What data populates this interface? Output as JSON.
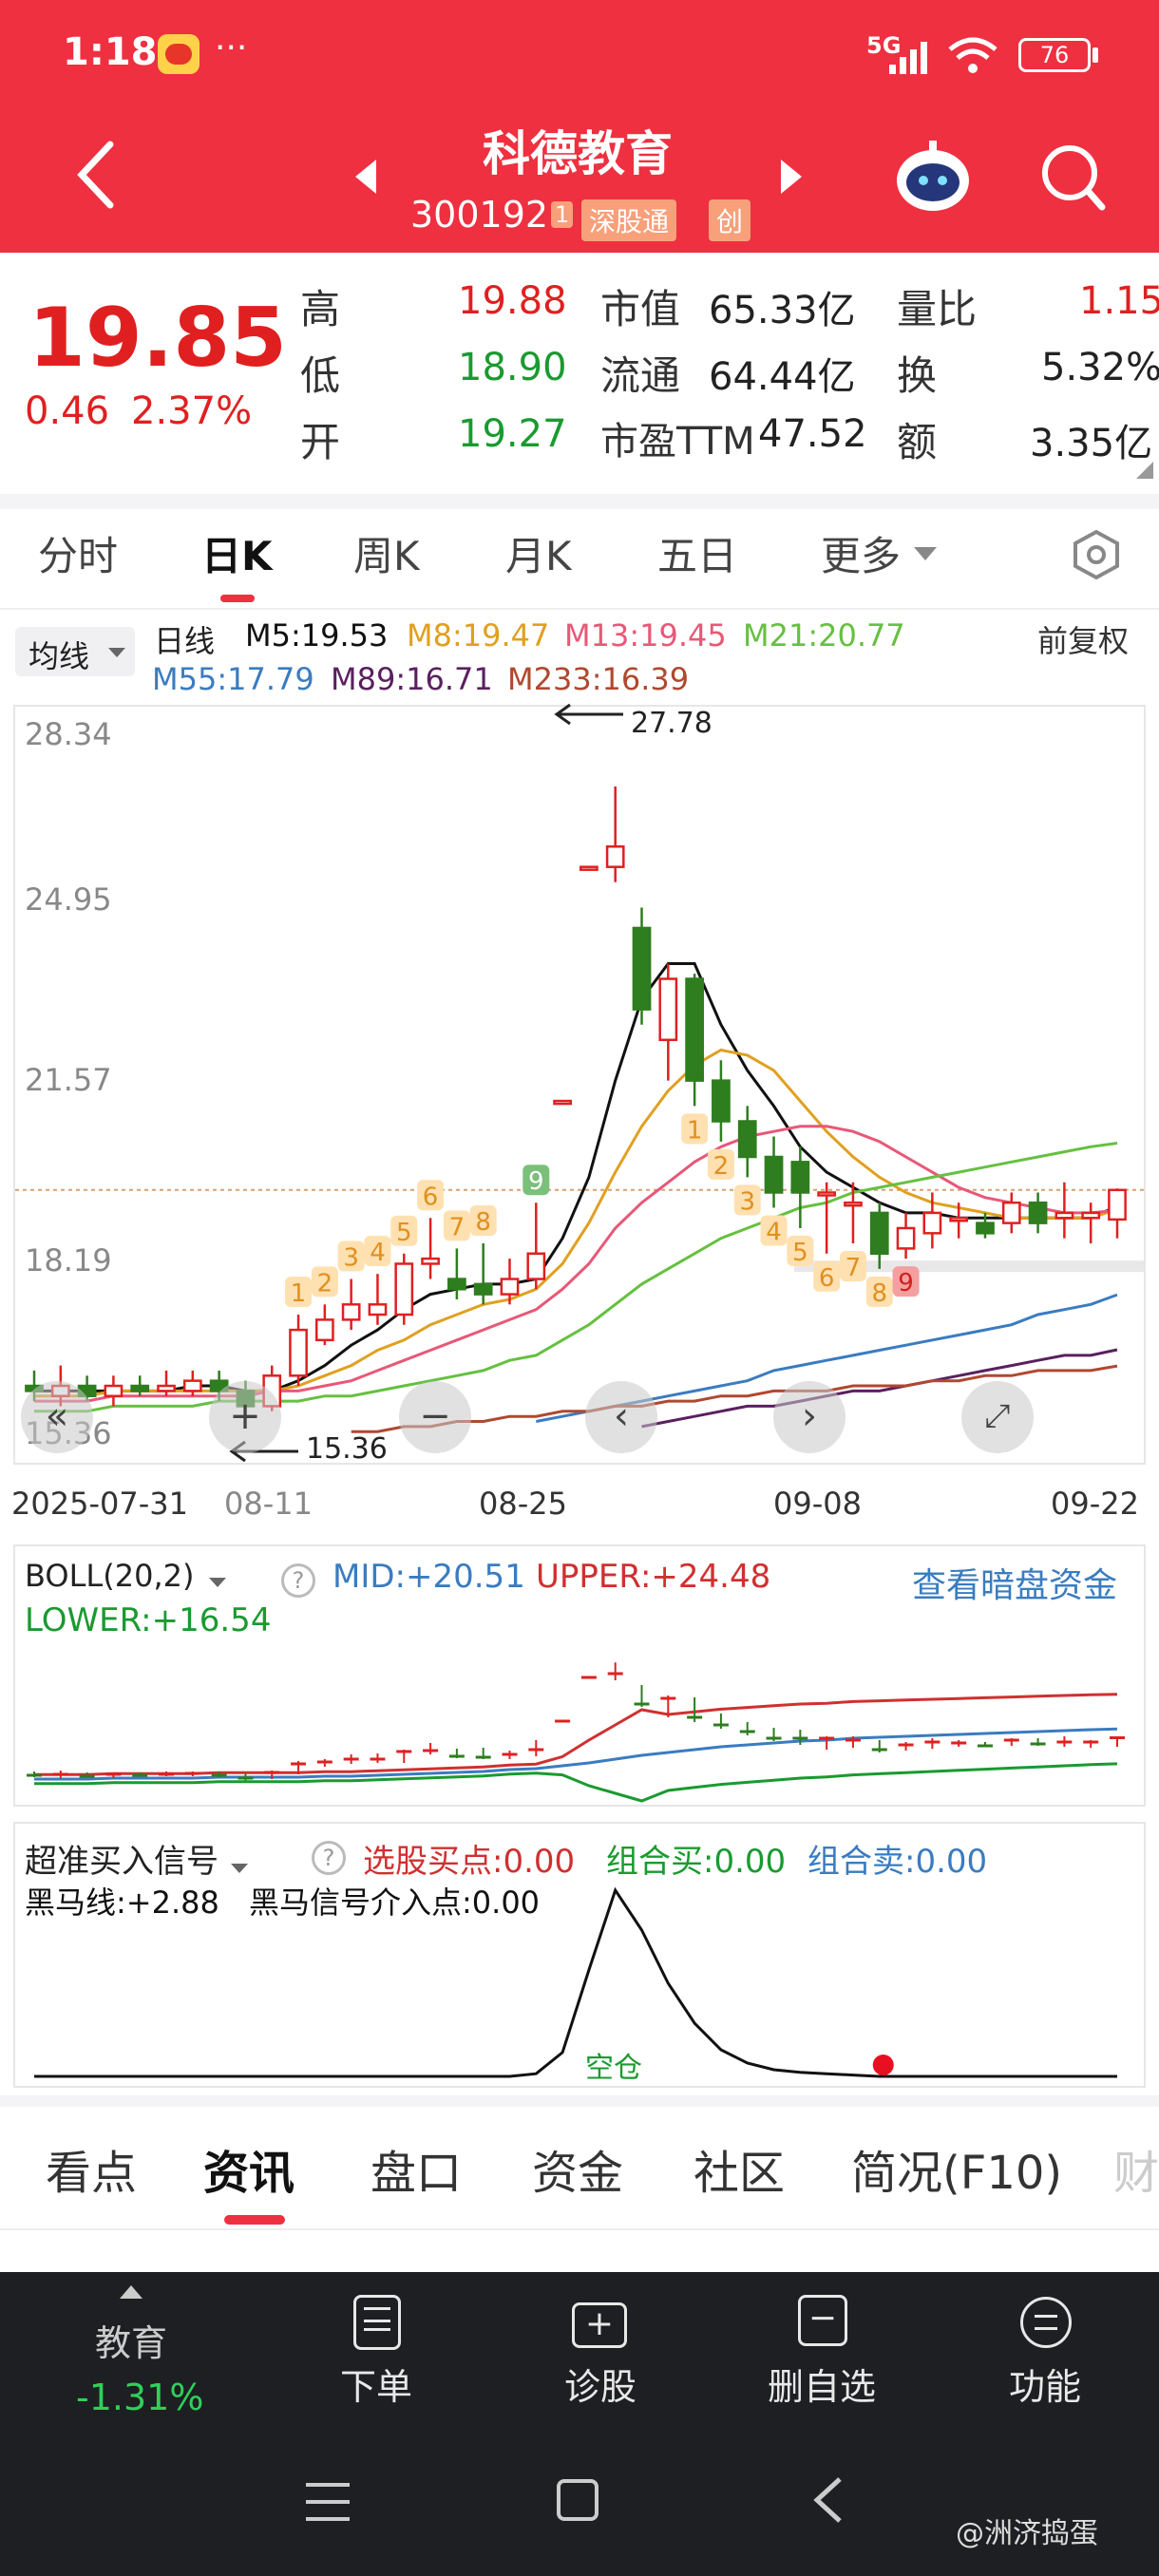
{
  "status_bar": {
    "time": "1:18",
    "dots": "···",
    "net": "5G",
    "battery": "76"
  },
  "header": {
    "title": "科德教育",
    "code": "300192",
    "code_mark": "1",
    "tag1": "深股通",
    "tag2": "创"
  },
  "quote": {
    "price": "19.85",
    "change": "0.46",
    "change_pct": "2.37%",
    "rows": [
      {
        "l1": "高",
        "v1": "19.88",
        "l2": "市值",
        "v2": "65.33亿",
        "l3": "量比",
        "v3": "1.15"
      },
      {
        "l1": "低",
        "v1": "18.90",
        "l2": "流通",
        "v2": "64.44亿",
        "l3": "换",
        "v3": "5.32%"
      },
      {
        "l1": "开",
        "v1": "19.27",
        "l2": "市盈TTM",
        "v2": "47.52",
        "l3": "额",
        "v3": "3.35亿"
      }
    ]
  },
  "tabs": [
    "分时",
    "日K",
    "周K",
    "月K",
    "五日",
    "更多"
  ],
  "ma_legend": {
    "selector": "均线",
    "period": "日线",
    "items": [
      {
        "text": "M5:19.53",
        "color": "#111111"
      },
      {
        "text": "M8:19.47",
        "color": "#e0a020"
      },
      {
        "text": "M13:19.45",
        "color": "#e85878"
      },
      {
        "text": "M21:20.77",
        "color": "#66c040"
      },
      {
        "text": "M55:17.79",
        "color": "#3a7cc0"
      },
      {
        "text": "M89:16.71",
        "color": "#5a2060"
      },
      {
        "text": "M233:16.39",
        "color": "#b04830"
      }
    ],
    "adjust": "前复权"
  },
  "chart_data": {
    "type": "candlestick",
    "y_ticks": [
      "28.34",
      "24.95",
      "21.57",
      "18.19",
      "15.36"
    ],
    "ylim": [
      14.6,
      29.2
    ],
    "x_ticks": [
      "2025-07-31",
      "08-11",
      "08-25",
      "09-08",
      "09-22"
    ],
    "annotations": {
      "high": "27.78",
      "low": "15.36"
    },
    "candles": [
      {
        "o": 16.0,
        "c": 15.9,
        "h": 16.3,
        "l": 15.7
      },
      {
        "o": 15.8,
        "c": 16.0,
        "h": 16.4,
        "l": 15.6
      },
      {
        "o": 16.0,
        "c": 15.8,
        "h": 16.2,
        "l": 15.7
      },
      {
        "o": 15.8,
        "c": 16.0,
        "h": 16.2,
        "l": 15.6
      },
      {
        "o": 16.0,
        "c": 15.9,
        "h": 16.2,
        "l": 15.8
      },
      {
        "o": 15.9,
        "c": 16.0,
        "h": 16.3,
        "l": 15.8
      },
      {
        "o": 15.9,
        "c": 16.1,
        "h": 16.3,
        "l": 15.8
      },
      {
        "o": 16.1,
        "c": 15.9,
        "h": 16.3,
        "l": 15.7
      },
      {
        "o": 15.9,
        "c": 15.6,
        "h": 16.1,
        "l": 15.36
      },
      {
        "o": 15.6,
        "c": 16.2,
        "h": 16.4,
        "l": 15.5
      },
      {
        "o": 16.2,
        "c": 17.1,
        "h": 17.4,
        "l": 16.0
      },
      {
        "o": 16.9,
        "c": 17.3,
        "h": 17.6,
        "l": 16.8
      },
      {
        "o": 17.3,
        "c": 17.6,
        "h": 18.1,
        "l": 17.1
      },
      {
        "o": 17.4,
        "c": 17.6,
        "h": 18.2,
        "l": 17.2
      },
      {
        "o": 17.4,
        "c": 18.4,
        "h": 18.6,
        "l": 17.2
      },
      {
        "o": 18.4,
        "c": 18.5,
        "h": 19.3,
        "l": 18.1
      },
      {
        "o": 18.1,
        "c": 17.9,
        "h": 18.7,
        "l": 17.7
      },
      {
        "o": 18.0,
        "c": 17.8,
        "h": 18.8,
        "l": 17.6
      },
      {
        "o": 17.8,
        "c": 18.1,
        "h": 18.5,
        "l": 17.6
      },
      {
        "o": 18.1,
        "c": 18.6,
        "h": 19.6,
        "l": 17.9
      },
      {
        "o": 21.6,
        "c": 21.6,
        "h": 21.6,
        "l": 21.6
      },
      {
        "o": 26.2,
        "c": 26.2,
        "h": 26.2,
        "l": 26.2
      },
      {
        "o": 26.2,
        "c": 26.6,
        "h": 27.78,
        "l": 25.9
      },
      {
        "o": 25.0,
        "c": 23.4,
        "h": 25.4,
        "l": 23.1
      },
      {
        "o": 22.8,
        "c": 24.0,
        "h": 24.3,
        "l": 22.0
      },
      {
        "o": 24.0,
        "c": 22.0,
        "h": 24.1,
        "l": 21.5
      },
      {
        "o": 22.0,
        "c": 21.2,
        "h": 22.4,
        "l": 20.8
      },
      {
        "o": 21.2,
        "c": 20.5,
        "h": 21.5,
        "l": 20.1
      },
      {
        "o": 20.5,
        "c": 19.8,
        "h": 20.9,
        "l": 19.5
      },
      {
        "o": 20.4,
        "c": 19.8,
        "h": 20.7,
        "l": 19.1
      },
      {
        "o": 19.8,
        "c": 19.8,
        "h": 20.0,
        "l": 18.6
      },
      {
        "o": 19.6,
        "c": 19.6,
        "h": 20.0,
        "l": 18.8
      },
      {
        "o": 19.4,
        "c": 18.6,
        "h": 19.6,
        "l": 18.3
      },
      {
        "o": 18.7,
        "c": 19.1,
        "h": 19.4,
        "l": 18.5
      },
      {
        "o": 19.0,
        "c": 19.4,
        "h": 19.8,
        "l": 18.7
      },
      {
        "o": 19.3,
        "c": 19.3,
        "h": 19.6,
        "l": 18.9
      },
      {
        "o": 19.2,
        "c": 19.0,
        "h": 19.4,
        "l": 18.9
      },
      {
        "o": 19.2,
        "c": 19.6,
        "h": 19.8,
        "l": 19.0
      },
      {
        "o": 19.6,
        "c": 19.2,
        "h": 19.8,
        "l": 19.0
      },
      {
        "o": 19.3,
        "c": 19.4,
        "h": 20.0,
        "l": 18.9
      },
      {
        "o": 19.3,
        "c": 19.4,
        "h": 19.6,
        "l": 18.8
      },
      {
        "o": 19.27,
        "c": 19.85,
        "h": 19.88,
        "l": 18.9
      }
    ],
    "ma_lines": [
      {
        "name": "M5",
        "color": "#111111",
        "values": [
          15.9,
          15.9,
          15.9,
          15.9,
          15.9,
          15.9,
          16.0,
          16.0,
          15.9,
          15.9,
          16.1,
          16.4,
          16.8,
          17.1,
          17.5,
          17.8,
          17.9,
          18.0,
          18.0,
          18.1,
          18.9,
          20.1,
          22.0,
          23.6,
          24.3,
          24.3,
          23.1,
          22.2,
          21.5,
          20.7,
          20.2,
          19.9,
          19.6,
          19.4,
          19.4,
          19.3,
          19.3,
          19.3,
          19.3,
          19.3,
          19.3,
          19.53
        ]
      },
      {
        "name": "M8",
        "color": "#e0a020",
        "values": [
          15.8,
          15.8,
          15.8,
          15.9,
          15.9,
          15.9,
          15.9,
          15.9,
          15.9,
          15.9,
          16.0,
          16.2,
          16.4,
          16.7,
          16.9,
          17.2,
          17.4,
          17.6,
          17.7,
          17.9,
          18.4,
          19.2,
          20.2,
          21.1,
          21.8,
          22.3,
          22.6,
          22.5,
          22.2,
          21.6,
          21.0,
          20.5,
          20.1,
          19.8,
          19.6,
          19.5,
          19.4,
          19.3,
          19.3,
          19.3,
          19.3,
          19.47
        ]
      },
      {
        "name": "M13",
        "color": "#e85878",
        "values": [
          15.7,
          15.7,
          15.7,
          15.8,
          15.8,
          15.8,
          15.8,
          15.8,
          15.8,
          15.9,
          15.9,
          16.0,
          16.1,
          16.3,
          16.5,
          16.7,
          16.9,
          17.1,
          17.3,
          17.5,
          17.9,
          18.4,
          19.1,
          19.6,
          20.0,
          20.4,
          20.7,
          20.9,
          21.0,
          21.1,
          21.1,
          21.0,
          20.8,
          20.5,
          20.2,
          19.9,
          19.7,
          19.6,
          19.5,
          19.4,
          19.4,
          19.45
        ]
      },
      {
        "name": "M21",
        "color": "#66c040",
        "values": [
          15.5,
          15.5,
          15.5,
          15.6,
          15.6,
          15.6,
          15.6,
          15.7,
          15.7,
          15.7,
          15.7,
          15.8,
          15.8,
          15.9,
          16.0,
          16.1,
          16.2,
          16.3,
          16.5,
          16.6,
          16.9,
          17.2,
          17.6,
          18.0,
          18.3,
          18.6,
          18.9,
          19.1,
          19.3,
          19.5,
          19.6,
          19.8,
          19.9,
          20.0,
          20.1,
          20.2,
          20.3,
          20.4,
          20.5,
          20.6,
          20.7,
          20.77
        ]
      },
      {
        "name": "M55",
        "color": "#3a7cc0",
        "values": [
          null,
          null,
          null,
          null,
          null,
          null,
          null,
          null,
          null,
          null,
          null,
          null,
          null,
          null,
          null,
          null,
          null,
          null,
          null,
          15.3,
          15.4,
          15.5,
          15.6,
          15.7,
          15.8,
          15.9,
          16.0,
          16.1,
          16.3,
          16.4,
          16.5,
          16.6,
          16.7,
          16.8,
          16.9,
          17.0,
          17.1,
          17.2,
          17.4,
          17.5,
          17.6,
          17.79
        ]
      },
      {
        "name": "M89",
        "color": "#5a2060",
        "values": [
          null,
          null,
          null,
          null,
          null,
          null,
          null,
          null,
          null,
          null,
          null,
          null,
          null,
          null,
          null,
          null,
          null,
          null,
          null,
          null,
          null,
          null,
          null,
          15.2,
          15.3,
          15.4,
          15.5,
          15.6,
          15.6,
          15.7,
          15.8,
          15.9,
          15.9,
          16.0,
          16.1,
          16.2,
          16.3,
          16.4,
          16.5,
          16.6,
          16.6,
          16.71
        ]
      },
      {
        "name": "M233",
        "color": "#b04830",
        "values": [
          null,
          null,
          null,
          null,
          null,
          null,
          null,
          null,
          null,
          null,
          null,
          null,
          15.1,
          15.1,
          15.2,
          15.2,
          15.3,
          15.3,
          15.4,
          15.4,
          15.5,
          15.5,
          15.6,
          15.6,
          15.7,
          15.7,
          15.8,
          15.8,
          15.9,
          15.9,
          15.9,
          16.0,
          16.0,
          16.0,
          16.1,
          16.1,
          16.2,
          16.2,
          16.3,
          16.3,
          16.3,
          16.39
        ]
      }
    ],
    "td_up": [
      {
        "i": 10,
        "n": "1"
      },
      {
        "i": 11,
        "n": "2"
      },
      {
        "i": 12,
        "n": "3"
      },
      {
        "i": 13,
        "n": "4"
      },
      {
        "i": 14,
        "n": "5"
      },
      {
        "i": 15,
        "n": "6"
      },
      {
        "i": 16,
        "n": "7"
      },
      {
        "i": 17,
        "n": "8"
      },
      {
        "i": 19,
        "n": "9"
      }
    ],
    "td_down": [
      {
        "i": 25,
        "n": "1"
      },
      {
        "i": 26,
        "n": "2"
      },
      {
        "i": 27,
        "n": "3"
      },
      {
        "i": 28,
        "n": "4"
      },
      {
        "i": 29,
        "n": "5"
      },
      {
        "i": 30,
        "n": "6"
      },
      {
        "i": 31,
        "n": "7"
      },
      {
        "i": 32,
        "n": "8"
      },
      {
        "i": 33,
        "n": "9"
      }
    ]
  },
  "boll": {
    "selector": "BOLL(20,2)",
    "mid": "MID:+20.51",
    "upper": "UPPER:+24.48",
    "lower": "LOWER:+16.54",
    "link": "查看暗盘资金"
  },
  "signal": {
    "selector": "超准买入信号",
    "s1": "选股买点:0.00",
    "s2": "组合买:0.00",
    "s3": "组合卖:0.00",
    "l1": "黑马线:+2.88",
    "l2": "黑马信号介入点:0.00",
    "marker": "空仓"
  },
  "bottom_tabs": [
    "看点",
    "资讯",
    "盘口",
    "资金",
    "社区",
    "简况(F10)",
    "财"
  ],
  "dock": {
    "sector_name": "教育",
    "sector_change": "-1.31%",
    "items": [
      "下单",
      "诊股",
      "删自选",
      "功能"
    ]
  },
  "watermark": "@洲济捣蛋"
}
